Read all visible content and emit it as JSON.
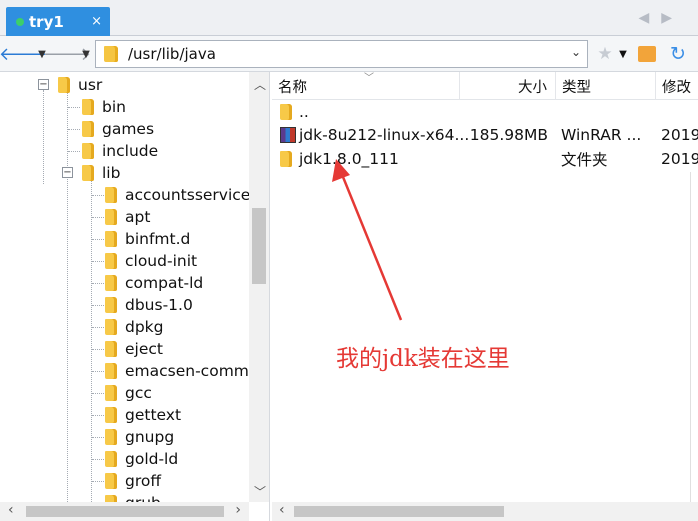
{
  "tab": {
    "title": "try1",
    "close": "×"
  },
  "toolbar": {
    "path": "/usr/lib/java"
  },
  "tree": {
    "root": "usr",
    "items": [
      {
        "label": "bin"
      },
      {
        "label": "games"
      },
      {
        "label": "include"
      },
      {
        "label": "lib"
      }
    ],
    "lib_children": [
      "accountsservice",
      "apt",
      "binfmt.d",
      "cloud-init",
      "compat-ld",
      "dbus-1.0",
      "dpkg",
      "eject",
      "emacsen-common",
      "gcc",
      "gettext",
      "gnupg",
      "gold-ld",
      "groff",
      "grub"
    ]
  },
  "list": {
    "columns": {
      "name": "名称",
      "size": "大小",
      "type": "类型",
      "modified": "修改"
    },
    "rows": [
      {
        "name": "..",
        "size": "",
        "type": "",
        "modified": ""
      },
      {
        "name": "jdk-8u212-linux-x64...",
        "size": "185.98MB",
        "type": "WinRAR ...",
        "modified": "2019"
      },
      {
        "name": "jdk1.8.0_111",
        "size": "",
        "type": "文件夹",
        "modified": "2019"
      }
    ]
  },
  "annotation": {
    "text": "我的jdk装在这里",
    "color": "#e53935"
  }
}
